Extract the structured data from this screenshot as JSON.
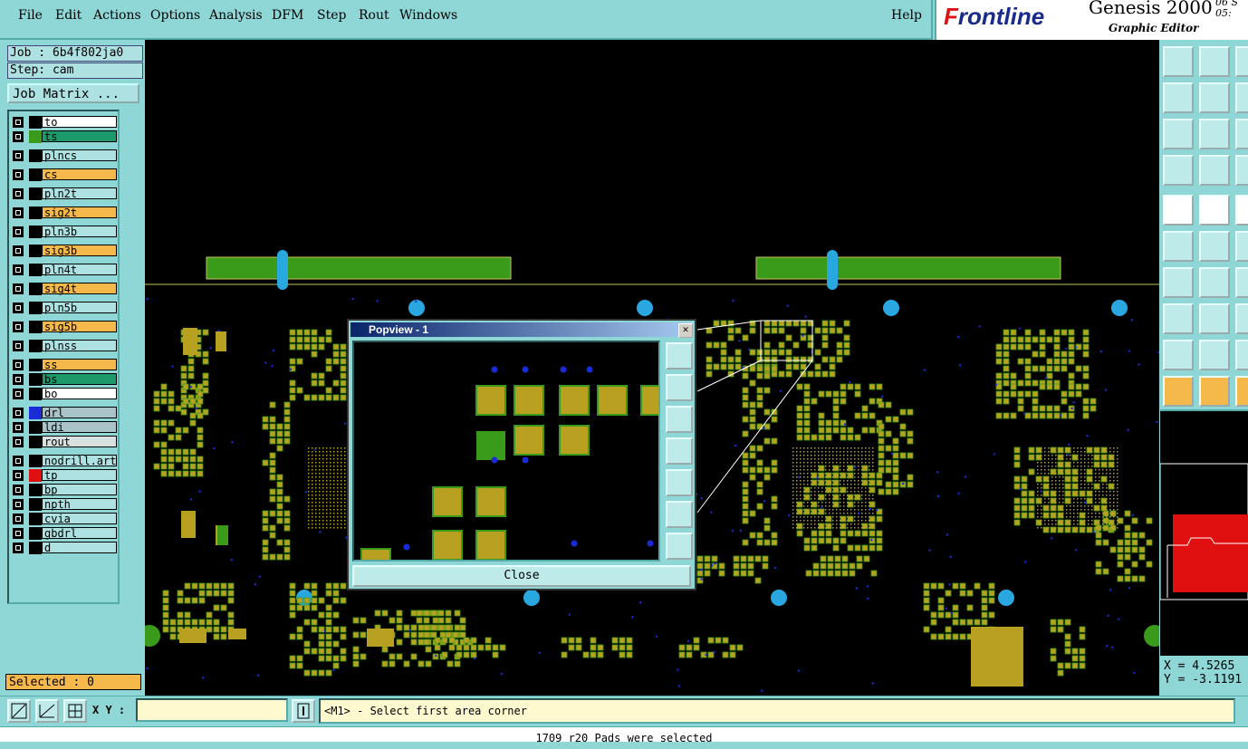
{
  "menu": [
    "File",
    "Edit",
    "Actions",
    "Options",
    "Analysis",
    "DFM",
    "Step",
    "Rout",
    "Windows"
  ],
  "help": "Help",
  "brand": {
    "logo_prefix": "F",
    "logo_rest": "rontline",
    "product": "Genesis 2000",
    "module": "Graphic Editor",
    "date_line1": "06 S",
    "date_line2": "05:"
  },
  "job": {
    "job_label": "Job : 6b4f802ja0",
    "step_label": "Step: cam",
    "matrix_button": "Job Matrix ..."
  },
  "layers": [
    {
      "name": "to",
      "color": "#ffffff",
      "swatch": "#000000",
      "mark": "⬋"
    },
    {
      "name": "ts",
      "color": "#1d9a6a",
      "swatch": "#3a9a1a",
      "mark": ""
    },
    {
      "name": "plncs",
      "color": "#aee2e2",
      "swatch": "#000000",
      "mark": ""
    },
    {
      "name": "cs",
      "color": "#f5b84a",
      "swatch": "#000000",
      "mark": ""
    },
    {
      "name": "pln2t",
      "color": "#aee2e2",
      "swatch": "#000000",
      "mark": ""
    },
    {
      "name": "sig2t",
      "color": "#f5b84a",
      "swatch": "#000000",
      "mark": ""
    },
    {
      "name": "pln3b",
      "color": "#aee2e2",
      "swatch": "#000000",
      "mark": ""
    },
    {
      "name": "sig3b",
      "color": "#f5b84a",
      "swatch": "#000000",
      "mark": ""
    },
    {
      "name": "pln4t",
      "color": "#aee2e2",
      "swatch": "#000000",
      "mark": ""
    },
    {
      "name": "sig4t",
      "color": "#f5b84a",
      "swatch": "#000000",
      "mark": ""
    },
    {
      "name": "pln5b",
      "color": "#aee2e2",
      "swatch": "#000000",
      "mark": ""
    },
    {
      "name": "sig5b",
      "color": "#f5b84a",
      "swatch": "#000000",
      "mark": ""
    },
    {
      "name": "plnss",
      "color": "#aee2e2",
      "swatch": "#000000",
      "mark": ""
    },
    {
      "name": "ss",
      "color": "#f5b84a",
      "swatch": "#000000",
      "mark": ""
    },
    {
      "name": "bs",
      "color": "#1d9a6a",
      "swatch": "#000000",
      "mark": ""
    },
    {
      "name": "bo",
      "color": "#ffffff",
      "swatch": "#000000",
      "mark": "⬋"
    },
    {
      "name": "drl",
      "color": "#a8c4c8",
      "swatch": "#1a2bd8",
      "mark": ""
    },
    {
      "name": "ldi",
      "color": "#a8c4c8",
      "swatch": "#000000",
      "mark": ""
    },
    {
      "name": "rout",
      "color": "#d8e0e0",
      "swatch": "#000000",
      "mark": ""
    },
    {
      "name": "nodrill.art",
      "color": "#aee2e2",
      "swatch": "#000000",
      "mark": ""
    },
    {
      "name": "tp",
      "color": "#aee2e2",
      "swatch": "#e01010",
      "mark": "⊞"
    },
    {
      "name": "bp",
      "color": "#aee2e2",
      "swatch": "#000000",
      "mark": ""
    },
    {
      "name": "npth",
      "color": "#aee2e2",
      "swatch": "#000000",
      "mark": ""
    },
    {
      "name": "cvia",
      "color": "#aee2e2",
      "swatch": "#000000",
      "mark": ""
    },
    {
      "name": "gbdrl",
      "color": "#aee2e2",
      "swatch": "#000000",
      "mark": ""
    },
    {
      "name": "d",
      "color": "#aee2e2",
      "swatch": "#000000",
      "mark": ""
    }
  ],
  "selected": "Selected : 0",
  "popview": {
    "title": "Popview - 1",
    "close_x": "✕",
    "close_button": "Close"
  },
  "coords": {
    "x": "X = 4.5265",
    "y": "Y = -3.1191"
  },
  "bottom": {
    "xy_label": "X Y :",
    "xy_value": "",
    "prompt": "<M1> - Select first area corner",
    "status": "1709 r20 Pads were selected"
  },
  "colors": {
    "copper": "#b8a020",
    "drill": "#29a8e0",
    "ts": "#3a9a1a",
    "via": "#1a2bd8",
    "accent": "#8fd6d6"
  }
}
